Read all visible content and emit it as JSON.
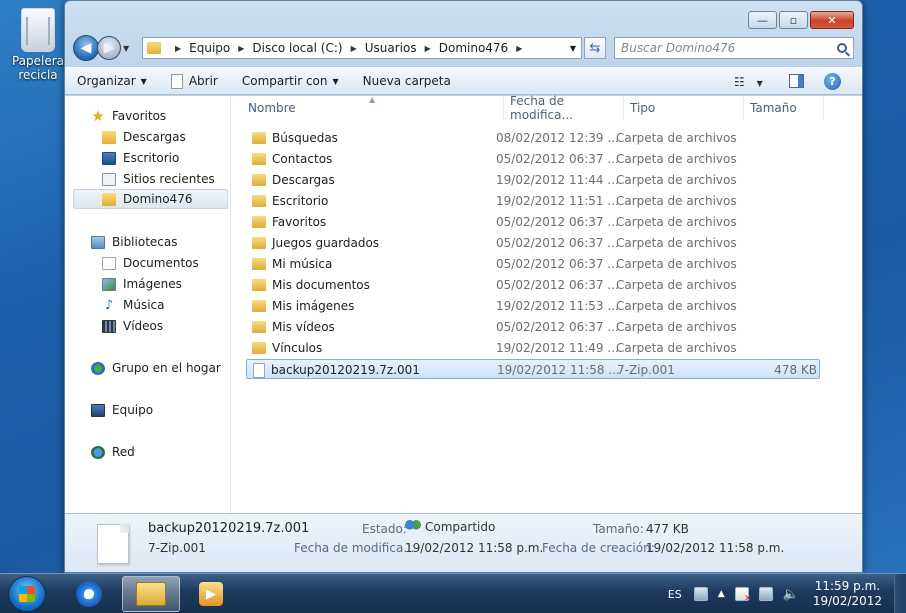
{
  "desktop": {
    "icon_label_line1": "Papelera",
    "icon_label_line2": "recicla"
  },
  "window": {
    "caption": {
      "min": "—",
      "max": "▫",
      "close": "✕"
    },
    "address": {
      "crumbs": [
        "Equipo",
        "Disco local (C:)",
        "Usuarios",
        "Domino476"
      ]
    },
    "search_placeholder": "Buscar Domino476",
    "toolbar": {
      "organize": "Organizar",
      "open": "Abrir",
      "share": "Compartir con",
      "new_folder": "Nueva carpeta",
      "help": "?"
    },
    "nav": {
      "favorites": "Favoritos",
      "fav_items": [
        "Descargas",
        "Escritorio",
        "Sitios recientes",
        "Domino476"
      ],
      "libraries": "Bibliotecas",
      "lib_items": [
        "Documentos",
        "Imágenes",
        "Música",
        "Vídeos"
      ],
      "homegroup": "Grupo en el hogar",
      "computer": "Equipo",
      "network": "Red"
    },
    "columns": {
      "name": "Nombre",
      "date": "Fecha de modifica...",
      "type": "Tipo",
      "size": "Tamaño"
    },
    "files": [
      {
        "name": "Búsquedas",
        "date": "08/02/2012 12:39 ...",
        "type": "Carpeta de archivos",
        "size": ""
      },
      {
        "name": "Contactos",
        "date": "05/02/2012 06:37 ...",
        "type": "Carpeta de archivos",
        "size": ""
      },
      {
        "name": "Descargas",
        "date": "19/02/2012 11:44 ...",
        "type": "Carpeta de archivos",
        "size": ""
      },
      {
        "name": "Escritorio",
        "date": "19/02/2012 11:51 ...",
        "type": "Carpeta de archivos",
        "size": ""
      },
      {
        "name": "Favoritos",
        "date": "05/02/2012 06:37 ...",
        "type": "Carpeta de archivos",
        "size": ""
      },
      {
        "name": "Juegos guardados",
        "date": "05/02/2012 06:37 ...",
        "type": "Carpeta de archivos",
        "size": ""
      },
      {
        "name": "Mi música",
        "date": "05/02/2012 06:37 ...",
        "type": "Carpeta de archivos",
        "size": ""
      },
      {
        "name": "Mis documentos",
        "date": "05/02/2012 06:37 ...",
        "type": "Carpeta de archivos",
        "size": ""
      },
      {
        "name": "Mis imágenes",
        "date": "19/02/2012 11:53 ...",
        "type": "Carpeta de archivos",
        "size": ""
      },
      {
        "name": "Mis vídeos",
        "date": "05/02/2012 06:37 ...",
        "type": "Carpeta de archivos",
        "size": ""
      },
      {
        "name": "Vínculos",
        "date": "19/02/2012 11:49 ...",
        "type": "Carpeta de archivos",
        "size": ""
      },
      {
        "name": "backup20120219.7z.001",
        "date": "19/02/2012 11:58 ...",
        "type": "7-Zip.001",
        "size": "478 KB",
        "selected": true,
        "is_file": true
      }
    ],
    "details": {
      "filename": "backup20120219.7z.001",
      "filetype": "7-Zip.001",
      "state_label": "Estado:",
      "state_value": "Compartido",
      "size_label": "Tamaño:",
      "size_value": "477 KB",
      "modified_label": "Fecha de modifica...",
      "modified_value": "19/02/2012 11:58 p.m.",
      "created_label": "Fecha de creación:",
      "created_value": "19/02/2012 11:58 p.m."
    }
  },
  "taskbar": {
    "ie_glyph": "e",
    "language": "ES",
    "time": "11:59 p.m.",
    "date": "19/02/2012"
  }
}
